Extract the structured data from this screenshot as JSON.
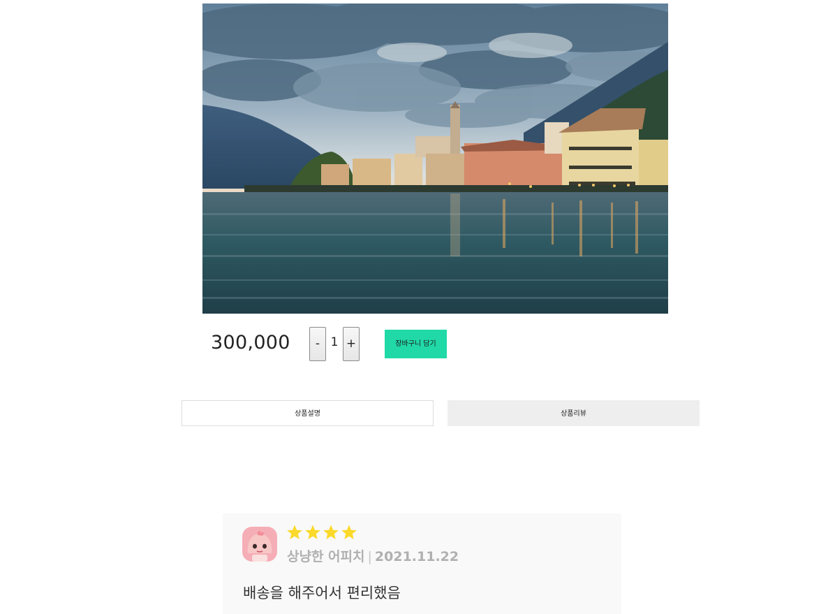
{
  "product": {
    "image_alt": "lakeside village photo",
    "price": "300,000",
    "quantity": "1",
    "minus_label": "-",
    "plus_label": "+",
    "cart_label": "장바구니 담기"
  },
  "tabs": [
    {
      "label": "상품설명",
      "active": false
    },
    {
      "label": "상품리뷰",
      "active": true
    }
  ],
  "review": {
    "rating": 4,
    "author": "상냥한 어피치",
    "separator": "|",
    "date": "2021.11.22",
    "text": "배송을 해주어서 편리했음",
    "avatar_icon": "apeach-avatar-icon",
    "star_icon": "star-icon"
  },
  "colors": {
    "accent": "#20d9a7",
    "star": "#fad92b",
    "tab_active_bg": "#eeeeee",
    "review_bg": "#f9f9f9"
  }
}
